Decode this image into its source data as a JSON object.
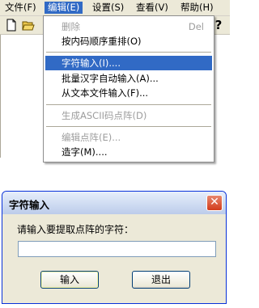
{
  "menubar": {
    "items": [
      {
        "label": "文件(F)"
      },
      {
        "label": "编辑(E)"
      },
      {
        "label": "设置(S)"
      },
      {
        "label": "查看(V)"
      },
      {
        "label": "帮助(H)"
      }
    ]
  },
  "toolbar": {
    "icons": [
      "new-file-icon",
      "open-folder-icon",
      "help-icon"
    ],
    "help_glyph": "?"
  },
  "edit_menu": {
    "items": [
      {
        "label": "删除",
        "shortcut": "Del",
        "disabled": true
      },
      {
        "label": "按内码顺序重排(O)"
      },
      {
        "label": "字符输入(I)....",
        "highlighted": true
      },
      {
        "label": "批量汉字自动输入(A)..."
      },
      {
        "label": "从文本文件输入(F)..."
      },
      {
        "label": "生成ASCII码点阵(D)",
        "disabled": true
      },
      {
        "label": "编辑点阵(E)...",
        "disabled": true
      },
      {
        "label": "造字(M)...."
      }
    ]
  },
  "dialog": {
    "title": "字符输入",
    "close_glyph": "✕",
    "prompt": "请输入要提取点阵的字符：",
    "input_value": "",
    "ok_label": "输入",
    "cancel_label": "退出"
  },
  "colors": {
    "menu_highlight": "#316ac5",
    "chrome": "#ece9d8",
    "close_button": "#d23c1c"
  }
}
